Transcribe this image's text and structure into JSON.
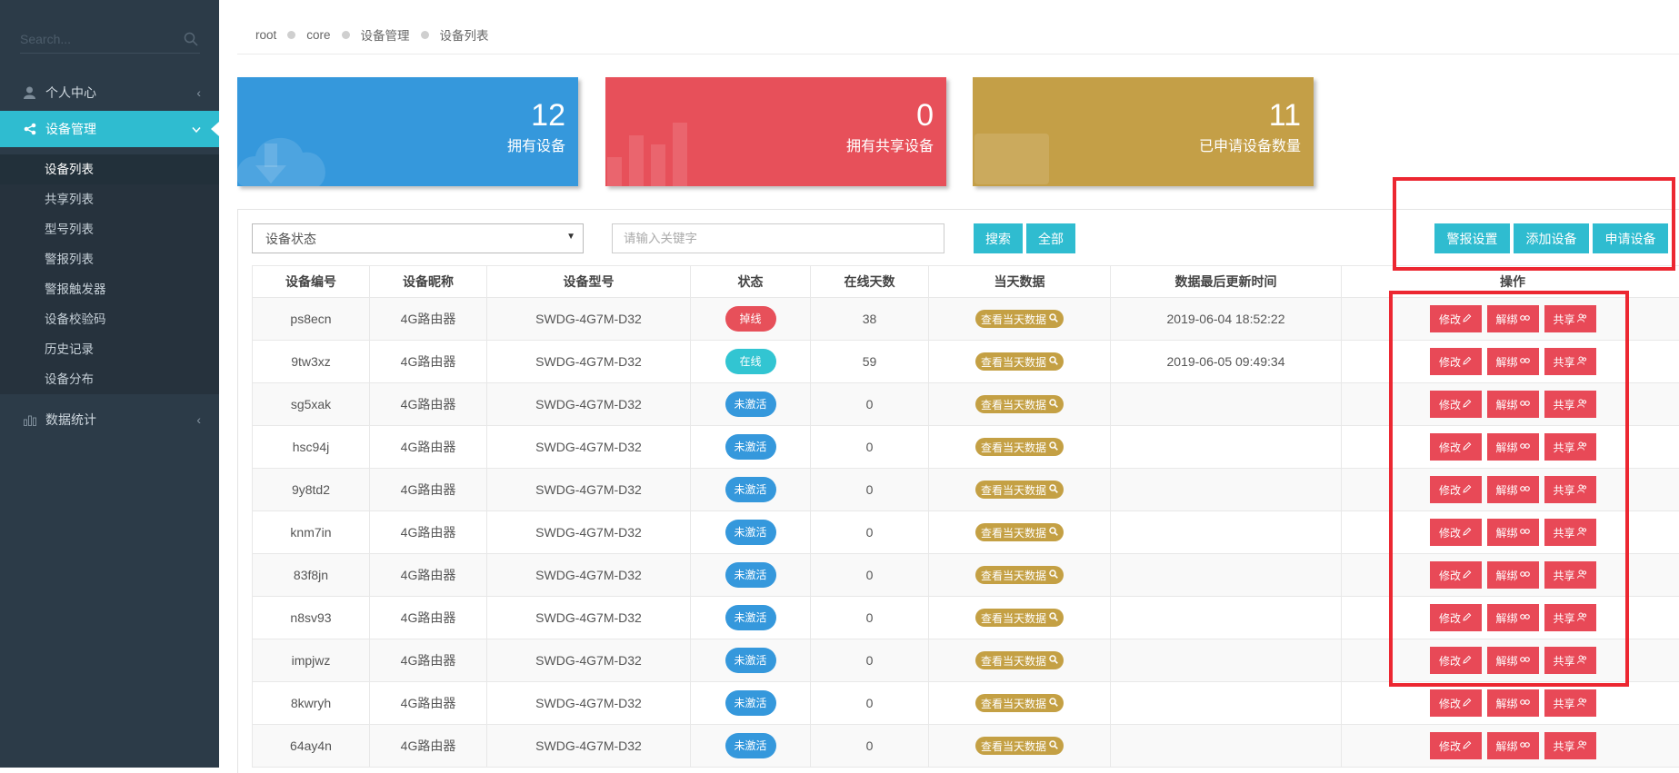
{
  "sidebar": {
    "search_placeholder": "Search...",
    "menu": [
      {
        "label": "个人中心",
        "icon": "user-icon"
      },
      {
        "label": "设备管理",
        "icon": "share-icon"
      },
      {
        "label": "数据统计",
        "icon": "bar-chart-icon"
      }
    ],
    "submenu": [
      "设备列表",
      "共享列表",
      "型号列表",
      "警报列表",
      "警报触发器",
      "设备校验码",
      "历史记录",
      "设备分布"
    ]
  },
  "breadcrumb": [
    "root",
    "core",
    "设备管理",
    "设备列表"
  ],
  "stats": [
    {
      "value": "12",
      "label": "拥有设备",
      "color": "#3598dc"
    },
    {
      "value": "0",
      "label": "拥有共享设备",
      "color": "#e7505a"
    },
    {
      "value": "11",
      "label": "已申请设备数量",
      "color": "#c49f47"
    }
  ],
  "filter": {
    "status_selected": "设备状态",
    "keyword_placeholder": "请输入关键字",
    "search_label": "搜索",
    "all_label": "全部"
  },
  "toolbar": {
    "alarm_settings": "警报设置",
    "add_device": "添加设备",
    "apply_device": "申请设备"
  },
  "table": {
    "headers": [
      "设备编号",
      "设备昵称",
      "设备型号",
      "状态",
      "在线天数",
      "当天数据",
      "数据最后更新时间",
      "操作"
    ],
    "view_label": "查看当天数据",
    "op_labels": {
      "edit": "修改",
      "unbind": "解绑",
      "share": "共享"
    },
    "status_colors": {
      "掉线": "#e7505a",
      "在线": "#32c5d2",
      "未激活": "#3598dc"
    },
    "rows": [
      {
        "id": "ps8ecn",
        "nick": "4G路由器",
        "model": "SWDG-4G7M-D32",
        "status": "掉线",
        "days": "38",
        "updated": "2019-06-04 18:52:22"
      },
      {
        "id": "9tw3xz",
        "nick": "4G路由器",
        "model": "SWDG-4G7M-D32",
        "status": "在线",
        "days": "59",
        "updated": "2019-06-05 09:49:34"
      },
      {
        "id": "sg5xak",
        "nick": "4G路由器",
        "model": "SWDG-4G7M-D32",
        "status": "未激活",
        "days": "0",
        "updated": ""
      },
      {
        "id": "hsc94j",
        "nick": "4G路由器",
        "model": "SWDG-4G7M-D32",
        "status": "未激活",
        "days": "0",
        "updated": ""
      },
      {
        "id": "9y8td2",
        "nick": "4G路由器",
        "model": "SWDG-4G7M-D32",
        "status": "未激活",
        "days": "0",
        "updated": ""
      },
      {
        "id": "knm7in",
        "nick": "4G路由器",
        "model": "SWDG-4G7M-D32",
        "status": "未激活",
        "days": "0",
        "updated": ""
      },
      {
        "id": "83f8jn",
        "nick": "4G路由器",
        "model": "SWDG-4G7M-D32",
        "status": "未激活",
        "days": "0",
        "updated": ""
      },
      {
        "id": "n8sv93",
        "nick": "4G路由器",
        "model": "SWDG-4G7M-D32",
        "status": "未激活",
        "days": "0",
        "updated": ""
      },
      {
        "id": "impjwz",
        "nick": "4G路由器",
        "model": "SWDG-4G7M-D32",
        "status": "未激活",
        "days": "0",
        "updated": ""
      },
      {
        "id": "8kwryh",
        "nick": "4G路由器",
        "model": "SWDG-4G7M-D32",
        "status": "未激活",
        "days": "0",
        "updated": ""
      },
      {
        "id": "64ay4n",
        "nick": "4G路由器",
        "model": "SWDG-4G7M-D32",
        "status": "未激活",
        "days": "0",
        "updated": ""
      }
    ]
  },
  "highlight_color": "#ec2731"
}
